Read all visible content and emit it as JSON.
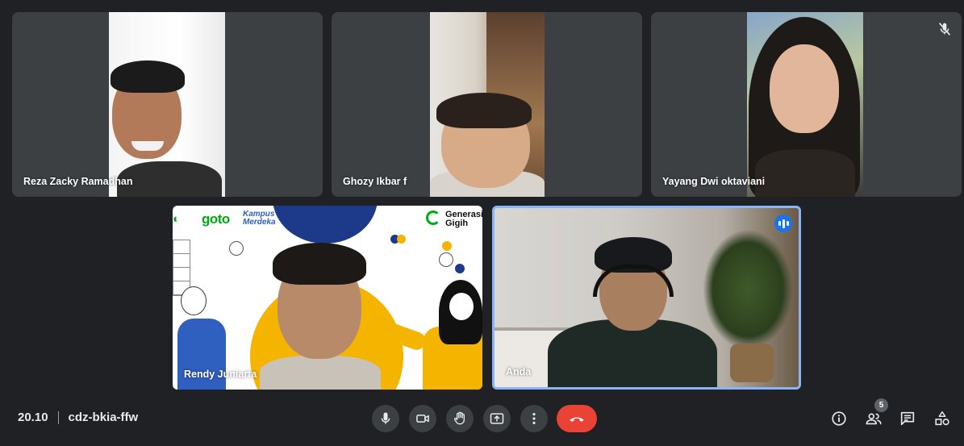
{
  "participants": [
    {
      "name": "Reza Zacky Ramadhan",
      "muted": false
    },
    {
      "name": "Ghozy Ikbar f",
      "muted": false
    },
    {
      "name": "Yayang Dwi oktaviani",
      "muted": true
    },
    {
      "name": "Rendy Juniarta",
      "muted": false
    },
    {
      "name": "Anda",
      "muted": false,
      "speaking": true
    }
  ],
  "background": {
    "brand_goto": "goto",
    "brand_kampus": "Kampus",
    "brand_merdeka": "Merdeka",
    "brand_generasi": "Generasi",
    "brand_gigih": "Gigih"
  },
  "meeting": {
    "time": "20.10",
    "code": "cdz-bkia-ffw"
  },
  "controls": [
    {
      "icon": "microphone-icon",
      "label": ""
    },
    {
      "icon": "camera-icon",
      "label": ""
    },
    {
      "icon": "raise-hand-icon",
      "label": ""
    },
    {
      "icon": "present-screen-icon",
      "label": ""
    },
    {
      "icon": "more-options-icon",
      "label": ""
    },
    {
      "icon": "end-call-icon",
      "label": ""
    }
  ],
  "right_controls": [
    {
      "icon": "info-icon"
    },
    {
      "icon": "people-icon",
      "badge": "5"
    },
    {
      "icon": "chat-icon"
    },
    {
      "icon": "activities-icon"
    }
  ],
  "colors": {
    "background": "#202124",
    "tile": "#3c4043",
    "end_call": "#ea4335",
    "speaking_border": "#8ab4f8",
    "speaking_badge": "#1a73e8"
  }
}
